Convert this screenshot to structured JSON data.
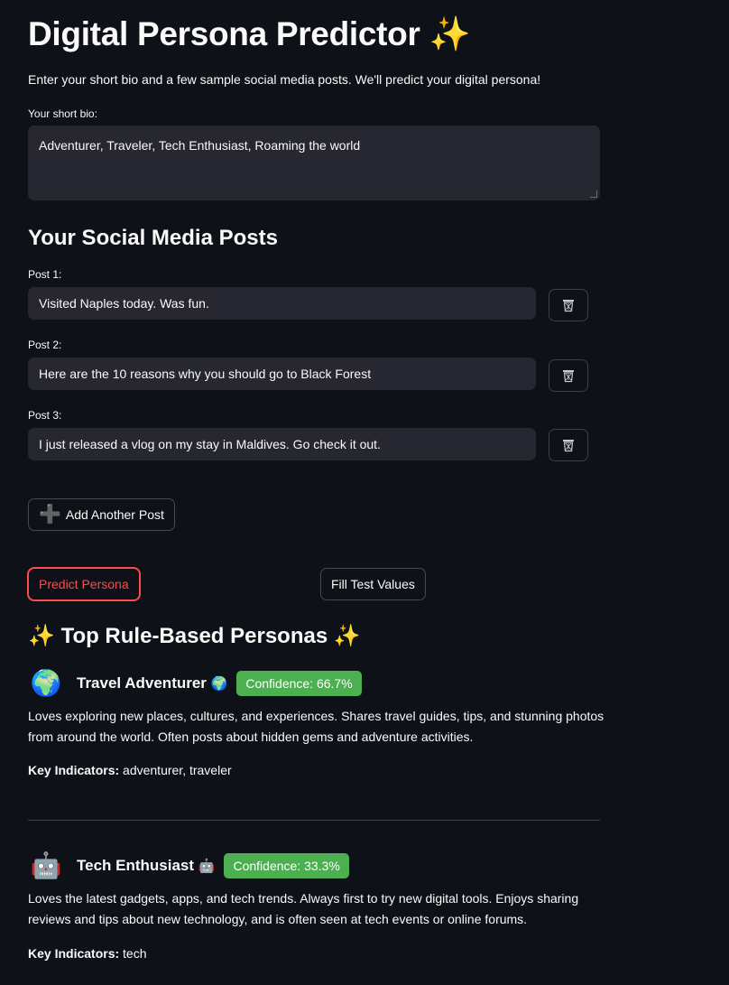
{
  "app": {
    "title": "Digital Persona Predictor",
    "title_icon": "✨",
    "intro": "Enter your short bio and a few sample social media posts. We'll predict your digital persona!"
  },
  "bio": {
    "label": "Your short bio:",
    "value": "Adventurer, Traveler, Tech Enthusiast, Roaming the world"
  },
  "posts": {
    "heading": "Your Social Media Posts",
    "items": [
      {
        "label": "Post 1:",
        "value": "Visited Naples today. Was fun."
      },
      {
        "label": "Post 2:",
        "value": "Here are the 10 reasons why you should go to Black Forest"
      },
      {
        "label": "Post 3:",
        "value": "I just released a vlog on my stay in Maldives. Go check it out."
      }
    ],
    "delete_icon": "trash-icon"
  },
  "actions": {
    "add_post_icon": "➕",
    "add_post_label": "Add Another Post",
    "predict_label": "Predict Persona",
    "fill_label": "Fill Test Values"
  },
  "results": {
    "heading_left": "✨",
    "heading_text": "Top Rule-Based Personas",
    "heading_right": "✨",
    "personas": [
      {
        "avatar": "🌍",
        "name": "Travel Adventurer",
        "name_icon": "🌍",
        "confidence": "Confidence: 66.7%",
        "description": "Loves exploring new places, cultures, and experiences. Shares travel guides, tips, and stunning photos from around the world. Often posts about hidden gems and adventure activities.",
        "indicators_label": "Key Indicators:",
        "indicators": " adventurer, traveler"
      },
      {
        "avatar": "🤖",
        "name": "Tech Enthusiast",
        "name_icon": "🤖",
        "confidence": "Confidence: 33.3%",
        "description": "Loves the latest gadgets, apps, and tech trends. Always first to try new digital tools. Enjoys sharing reviews and tips about new technology, and is often seen at tech events or online forums.",
        "indicators_label": "Key Indicators:",
        "indicators": " tech"
      }
    ]
  },
  "colors": {
    "background": "#0e1117",
    "input_bg": "#262730",
    "accent_red": "#ff4b4b",
    "badge_green": "#4caf50"
  }
}
